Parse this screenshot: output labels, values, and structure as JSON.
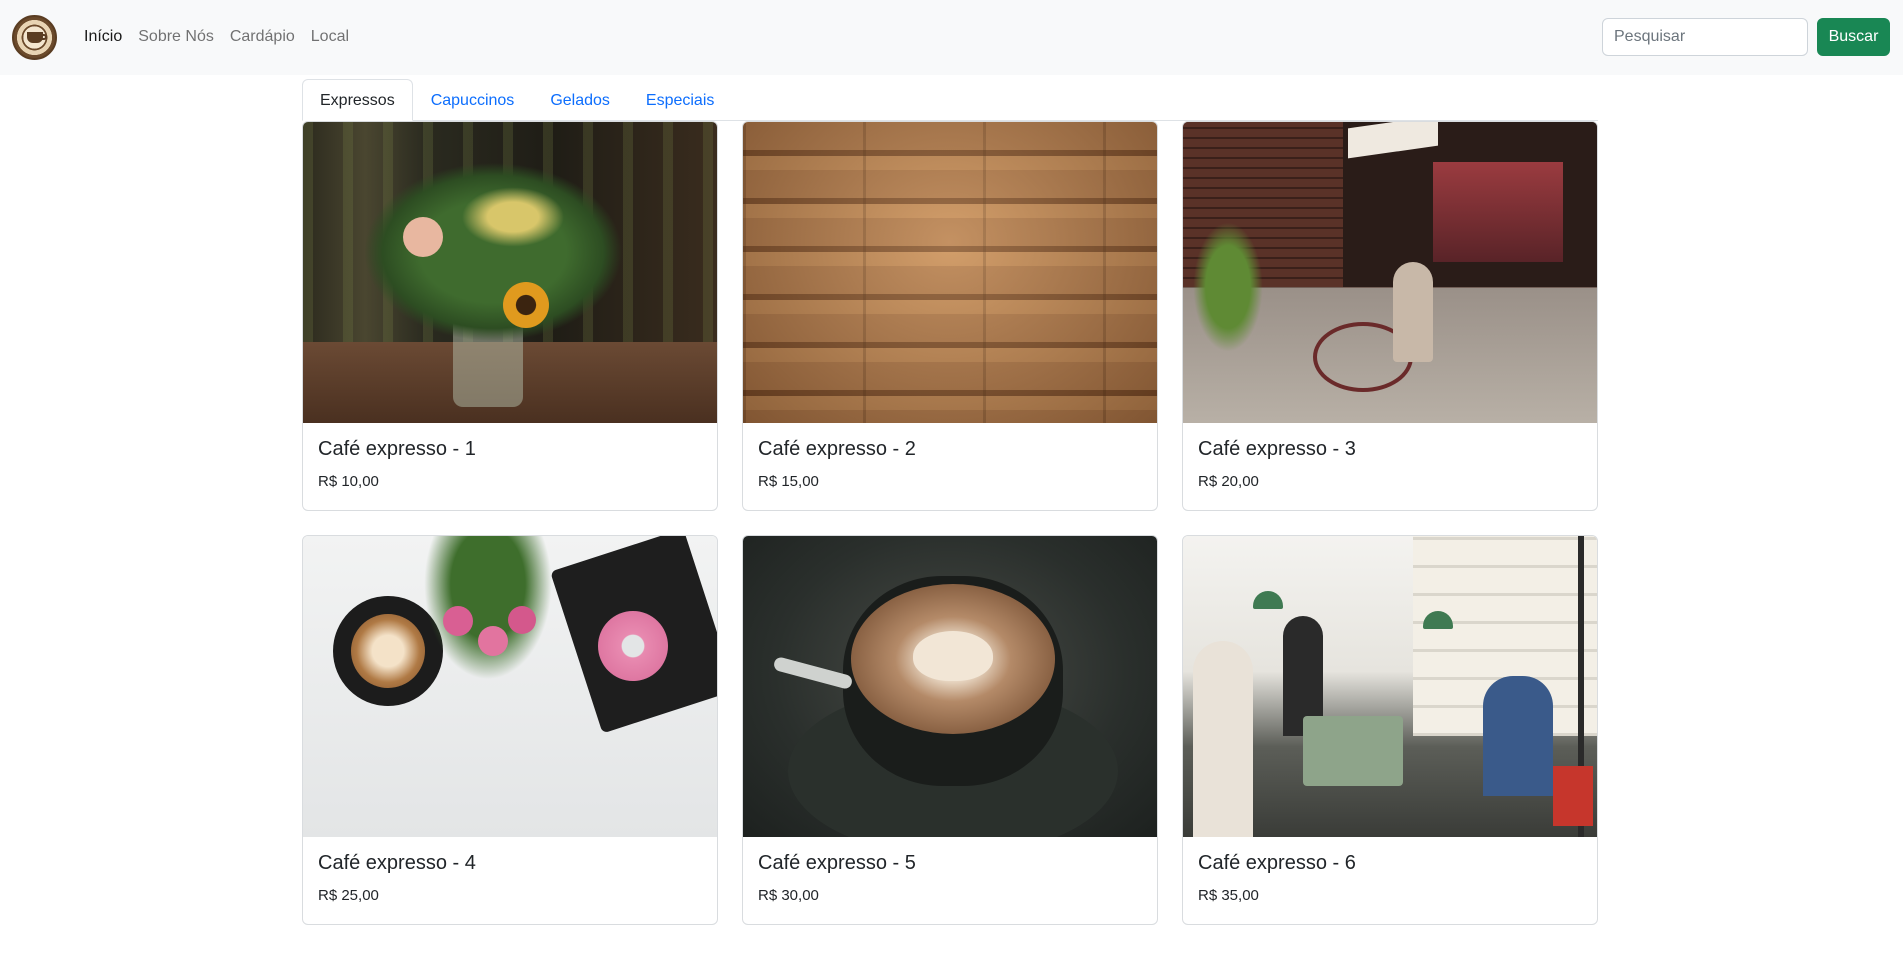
{
  "navbar": {
    "logo": "cafe-logo-icon",
    "links": [
      {
        "label": "Início",
        "active": true
      },
      {
        "label": "Sobre Nós",
        "active": false
      },
      {
        "label": "Cardápio",
        "active": false
      },
      {
        "label": "Local",
        "active": false
      }
    ],
    "search": {
      "placeholder": "Pesquisar",
      "value": ""
    },
    "search_button": "Buscar"
  },
  "tabs": [
    {
      "label": "Expressos",
      "active": true
    },
    {
      "label": "Capuccinos",
      "active": false
    },
    {
      "label": "Gelados",
      "active": false
    },
    {
      "label": "Especiais",
      "active": false
    }
  ],
  "products": [
    {
      "name": "Café expresso - 1",
      "price": "R$ 10,00",
      "image": "flower-bouquet-photo"
    },
    {
      "name": "Café expresso - 2",
      "price": "R$ 15,00",
      "image": "coffee-sacks-photo"
    },
    {
      "name": "Café expresso - 3",
      "price": "R$ 20,00",
      "image": "cafe-storefront-photo"
    },
    {
      "name": "Café expresso - 4",
      "price": "R$ 25,00",
      "image": "coffee-flowers-donut-photo"
    },
    {
      "name": "Café expresso - 5",
      "price": "R$ 30,00",
      "image": "latte-art-photo"
    },
    {
      "name": "Café expresso - 6",
      "price": "R$ 35,00",
      "image": "cafe-interior-photo"
    }
  ],
  "colors": {
    "navbar_bg": "#f8f9fa",
    "link_blue": "#0d6efd",
    "button_green": "#198754",
    "border": "#dee2e6"
  }
}
